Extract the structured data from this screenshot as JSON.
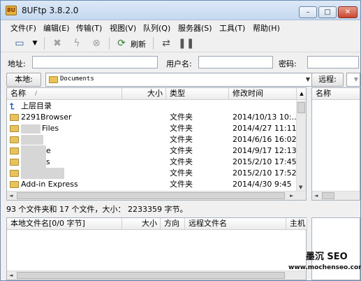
{
  "window": {
    "title": "8UFtp 3.8.2.0",
    "app_icon_label": "8U",
    "min_label": "–",
    "max_label": "□",
    "close_label": "✕"
  },
  "menu": [
    "文件(F)",
    "编辑(E)",
    "传输(T)",
    "视图(V)",
    "队列(Q)",
    "服务器(S)",
    "工具(T)",
    "帮助(H)"
  ],
  "toolbar": {
    "refresh_label": "刷新"
  },
  "address": {
    "host_label": "地址:",
    "user_label": "用户名:",
    "pass_label": "密码:",
    "host_value": "",
    "user_value": "",
    "pass_value": ""
  },
  "local": {
    "path_label": "本地:",
    "path_value": "Documents",
    "columns": [
      "名称",
      "大小",
      "类型",
      "修改时间"
    ],
    "sort_indicator": "/",
    "parent_label": "上层目录",
    "rows": [
      {
        "name": "2291Browser",
        "size": "",
        "type": "文件夹",
        "modified": "2014/10/13 10:..."
      },
      {
        "name": "Files",
        "size": "",
        "type": "文件夹",
        "modified": "2014/4/27 11:11"
      },
      {
        "name": "",
        "size": "",
        "type": "文件夹",
        "modified": "2014/6/16 16:02"
      },
      {
        "name": "e",
        "size": "",
        "type": "文件夹",
        "modified": "2014/9/17 12:13"
      },
      {
        "name": "s",
        "size": "",
        "type": "文件夹",
        "modified": "2015/2/10 17:45"
      },
      {
        "name": "s",
        "size": "",
        "type": "文件夹",
        "modified": "2015/2/10 17:52"
      },
      {
        "name": "Add-in Express",
        "size": "",
        "type": "文件夹",
        "modified": "2014/4/30 9:45"
      }
    ],
    "status": "93 个文件夹和 17 个文件，大小： 2233359 字节。"
  },
  "queue": {
    "columns": [
      "本地文件名[0/0 字节]",
      "大小",
      "方向",
      "远程文件名",
      "主机"
    ]
  },
  "remote": {
    "path_label": "远程:",
    "columns": [
      "名称"
    ]
  },
  "watermark": {
    "title": "墨沉 SEO",
    "url": "www.mochenseo.com"
  }
}
